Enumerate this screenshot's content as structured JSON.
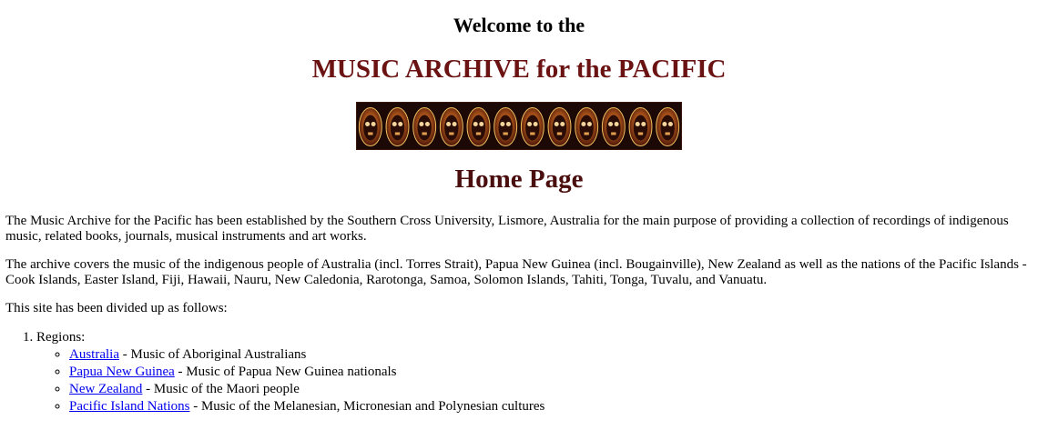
{
  "header": {
    "welcome": "Welcome to the",
    "site_title": "MUSIC ARCHIVE for the PACIFIC",
    "page_title": "Home Page"
  },
  "colors": {
    "title_maroon": "#6b1212",
    "home_title": "#4a0e0e",
    "link_blue": "#0000ee"
  },
  "banner": {
    "icon": "carved-masks-banner",
    "mask_count": 12
  },
  "content": {
    "intro": "The Music Archive for the Pacific has been established by the Southern Cross University, Lismore, Australia for the main purpose of providing a collection of recordings of indigenous music, related books, journals, musical instruments and art works.",
    "covers": "The archive covers the music of the indigenous people of Australia (incl. Torres Strait), Papua New Guinea (incl. Bougainville), New Zealand as well as the nations of the Pacific Islands - Cook Islands, Easter Island, Fiji, Hawaii, Nauru, New Caledonia, Rarotonga, Samoa, Solomon Islands, Tahiti, Tonga, Tuvalu, and Vanuatu.",
    "divided": "This site has been divided up as follows:"
  },
  "sections": [
    {
      "label": "Regions:",
      "regions": [
        {
          "link": "Australia",
          "desc": " - Music of Aboriginal Australians"
        },
        {
          "link": "Papua New Guinea",
          "desc": " - Music of Papua New Guinea nationals"
        },
        {
          "link": "New Zealand",
          "desc": " - Music of the Maori people"
        },
        {
          "link": "Pacific Island Nations",
          "desc": " - Music of the Melanesian, Micronesian and Polynesian cultures"
        }
      ]
    }
  ]
}
